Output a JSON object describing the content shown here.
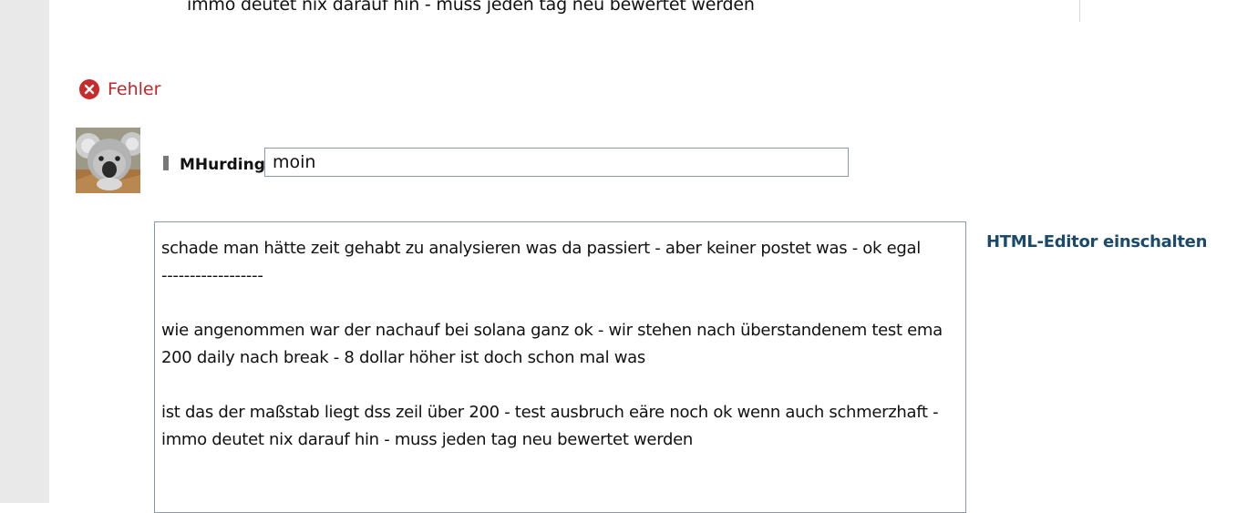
{
  "previous_post": {
    "text": "immo deutet nix darauf hin - muss jeden tag neu bewertet werden"
  },
  "error": {
    "icon": "error-x-icon",
    "color": "#c0262c",
    "label": "Fehler"
  },
  "reply": {
    "avatar": "koala-avatar",
    "username": "MHurding:",
    "subject_value": "moin"
  },
  "editor": {
    "lines": [
      "schade man hätte zeit gehabt zu analysieren was da passiert - aber keiner postet was - ok egal",
      "------------------",
      "",
      "wie angenommen war der nachauf bei solana ganz ok - wir stehen nach überstandenem test ema 200 daily nach break - 8 dollar höher ist doch schon mal was",
      "",
      "ist das der maßstab liegt dss zeil über 200 - test ausbruch eäre noch ok wenn auch schmerzhaft - immo deutet nix darauf hin - muss jeden tag neu bewertet werden"
    ]
  },
  "html_editor_toggle": {
    "label": "HTML-Editor einschalten",
    "color": "#1b4a6b"
  }
}
